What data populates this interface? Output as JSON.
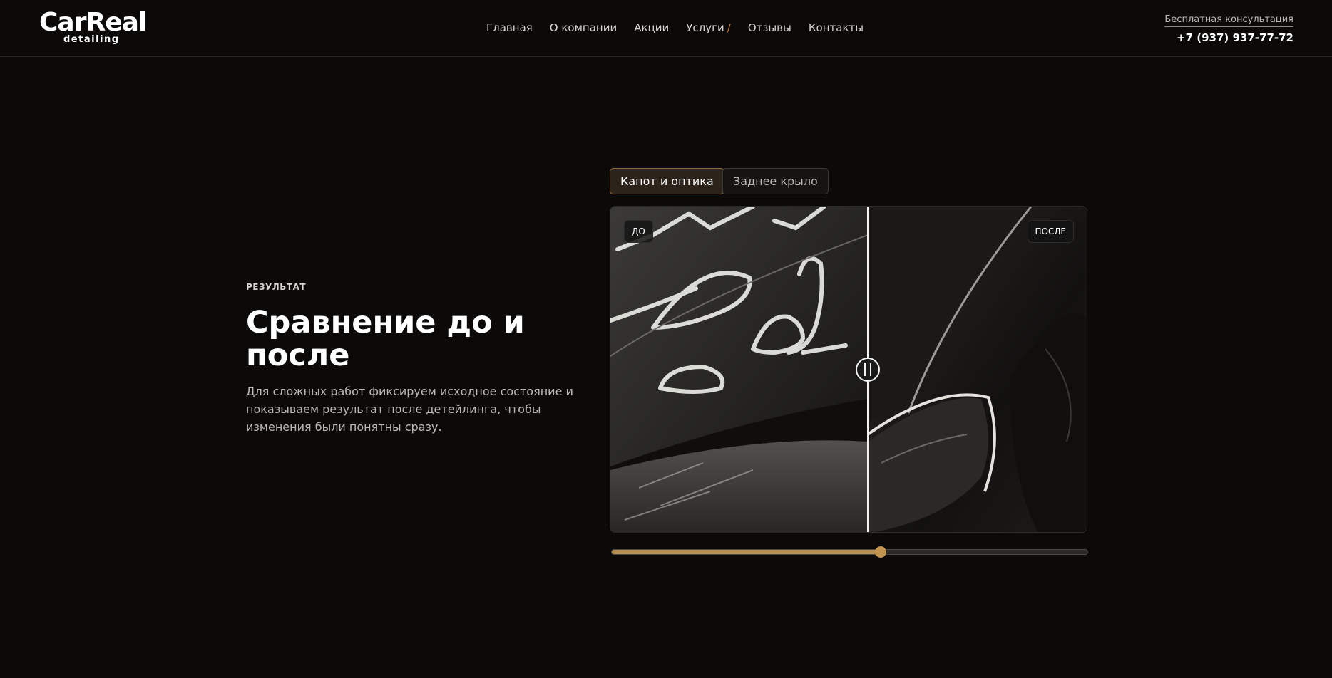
{
  "header": {
    "logo_main": "CarReal",
    "logo_sub": "detailing",
    "nav": [
      {
        "label": "Главная"
      },
      {
        "label": "О компании"
      },
      {
        "label": "Акции"
      },
      {
        "label": "Услуги"
      },
      {
        "label": "Отзывы"
      },
      {
        "label": "Контакты"
      }
    ],
    "nav_services_marker": "/",
    "consult_label": "Бесплатная консультация",
    "phone": "+7 (937) 937-77-72"
  },
  "section": {
    "eyebrow": "РЕЗУЛЬТАТ",
    "title": "Сравнение до и после",
    "description": "Для сложных работ фиксируем исходное состояние и показываем результат после детейлинга, чтобы изменения были понятны сразу."
  },
  "tabs": [
    {
      "label": "Капот и оптика",
      "active": true
    },
    {
      "label": "Заднее крыло",
      "active": false
    }
  ],
  "comparison": {
    "before_label": "ДО",
    "after_label": "ПОСЛЕ",
    "slider_value": 0.565
  },
  "colors": {
    "background": "#0b0a09",
    "accent": "#b88f4e",
    "nav_marker": "#c0742f"
  }
}
